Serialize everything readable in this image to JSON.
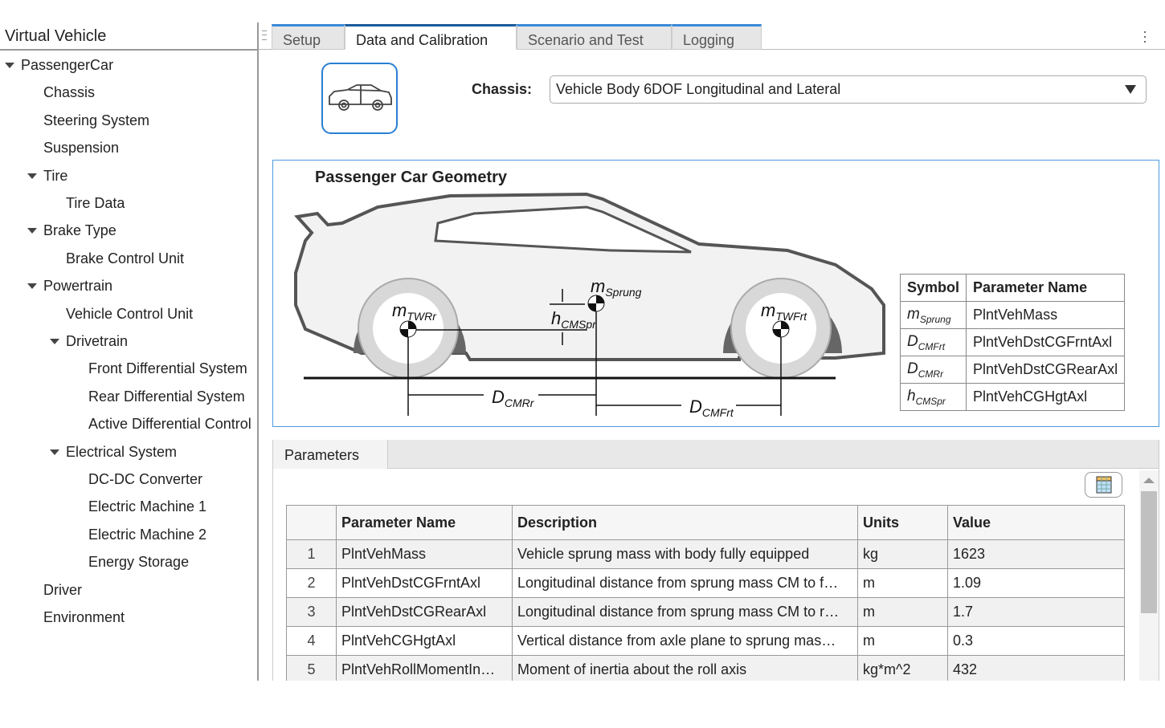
{
  "sidebar": {
    "title": "Virtual Vehicle",
    "items": [
      {
        "label": "PassengerCar",
        "level": 0,
        "expanded": true
      },
      {
        "label": "Chassis",
        "level": 1
      },
      {
        "label": "Steering System",
        "level": 1
      },
      {
        "label": "Suspension",
        "level": 1
      },
      {
        "label": "Tire",
        "level": 1,
        "expanded": true
      },
      {
        "label": "Tire Data",
        "level": 2
      },
      {
        "label": "Brake Type",
        "level": 1,
        "expanded": true
      },
      {
        "label": "Brake Control Unit",
        "level": 2
      },
      {
        "label": "Powertrain",
        "level": 1,
        "expanded": true
      },
      {
        "label": "Vehicle Control Unit",
        "level": 2
      },
      {
        "label": "Drivetrain",
        "level": 2,
        "expanded": true
      },
      {
        "label": "Front Differential System",
        "level": 3
      },
      {
        "label": "Rear Differential System",
        "level": 3
      },
      {
        "label": "Active Differential Control",
        "level": 3
      },
      {
        "label": "Electrical System",
        "level": 2,
        "expanded": true
      },
      {
        "label": "DC-DC Converter",
        "level": 3
      },
      {
        "label": "Electric Machine 1",
        "level": 3
      },
      {
        "label": "Electric Machine 2",
        "level": 3
      },
      {
        "label": "Energy Storage",
        "level": 3
      },
      {
        "label": "Driver",
        "level": 1
      },
      {
        "label": "Environment",
        "level": 1
      }
    ]
  },
  "tabs": [
    {
      "label": "Setup"
    },
    {
      "label": "Data and Calibration",
      "active": true
    },
    {
      "label": "Scenario and Test"
    },
    {
      "label": "Logging"
    }
  ],
  "chassis": {
    "label": "Chassis:",
    "value": "Vehicle Body 6DOF Longitudinal and Lateral",
    "icon": "car-icon"
  },
  "geometry": {
    "title": "Passenger Car Geometry",
    "labels": {
      "m_sprung": [
        "m",
        "Sprung"
      ],
      "m_twrr": [
        "m",
        "TWRr"
      ],
      "m_twfrt": [
        "m",
        "TWFrt"
      ],
      "h_cmspr": [
        "h",
        "CMSpr"
      ],
      "d_cmrr": [
        "D",
        "CMRr"
      ],
      "d_cmfrt": [
        "D",
        "CMFrt"
      ]
    },
    "table": {
      "headers": [
        "Symbol",
        "Parameter Name"
      ],
      "rows": [
        {
          "sym": "m",
          "sub": "Sprung",
          "name": "PlntVehMass"
        },
        {
          "sym": "D",
          "sub": "CMFrt",
          "name": "PlntVehDstCGFrntAxl"
        },
        {
          "sym": "D",
          "sub": "CMRr",
          "name": "PlntVehDstCGRearAxl"
        },
        {
          "sym": "h",
          "sub": "CMSpr",
          "name": "PlntVehCGHgtAxl"
        }
      ]
    }
  },
  "parameters": {
    "tab": "Parameters",
    "headers": [
      "",
      "Parameter Name",
      "Description",
      "Units",
      "Value"
    ],
    "rows": [
      [
        "1",
        "PlntVehMass",
        "Vehicle sprung mass with body fully equipped",
        "kg",
        "1623"
      ],
      [
        "2",
        "PlntVehDstCGFrntAxl",
        "Longitudinal distance from sprung mass CM to f…",
        "m",
        "1.09"
      ],
      [
        "3",
        "PlntVehDstCGRearAxl",
        "Longitudinal distance from sprung mass CM to r…",
        "m",
        "1.7"
      ],
      [
        "4",
        "PlntVehCGHgtAxl",
        "Vertical distance from axle plane to sprung mas…",
        "m",
        "0.3"
      ],
      [
        "5",
        "PlntVehRollMomentIn…",
        "Moment of inertia about the roll axis",
        "kg*m^2",
        "432"
      ]
    ]
  }
}
